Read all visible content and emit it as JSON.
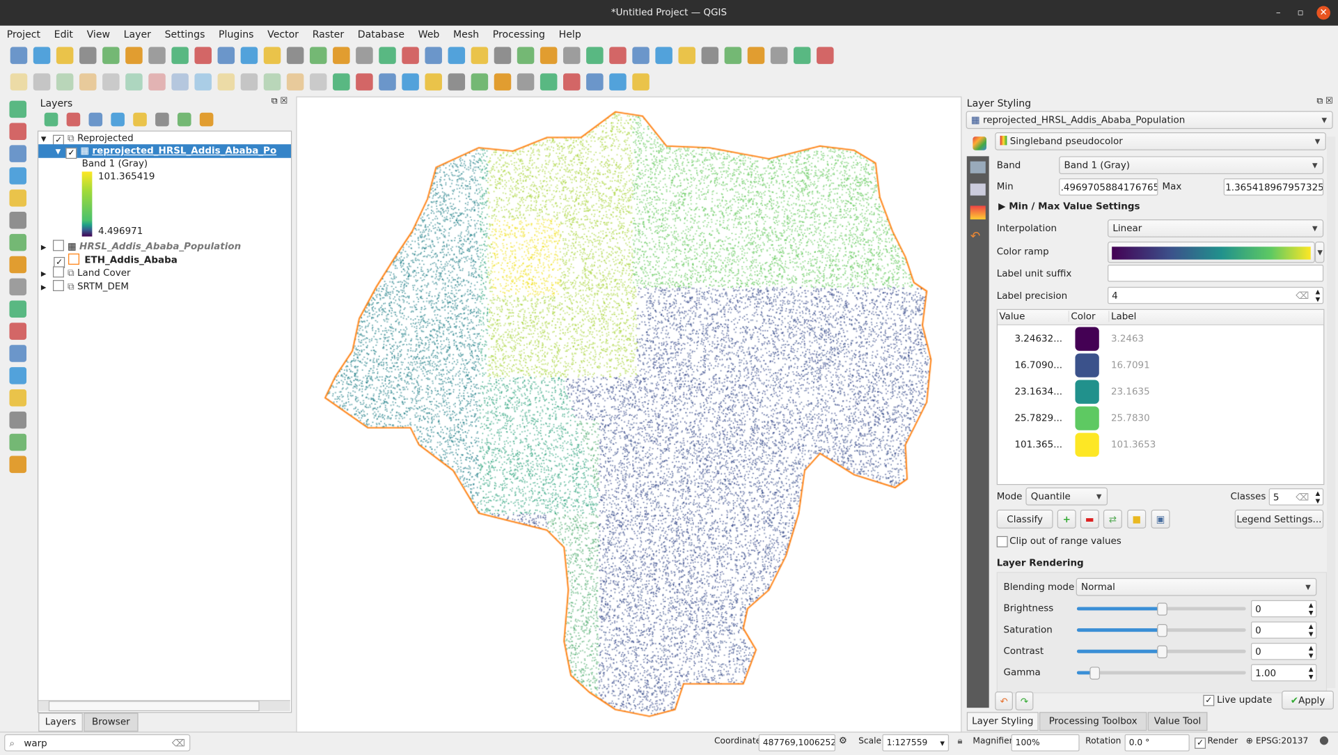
{
  "window": {
    "title": "*Untitled Project — QGIS"
  },
  "menu": [
    "Project",
    "Edit",
    "View",
    "Layer",
    "Settings",
    "Plugins",
    "Vector",
    "Raster",
    "Database",
    "Web",
    "Mesh",
    "Processing",
    "Help"
  ],
  "layers_panel": {
    "title": "Layers",
    "tree": [
      {
        "name": "Reprojected",
        "checked": true,
        "type": "group"
      },
      {
        "name": "reprojected_HRSL_Addis_Ababa_Po",
        "checked": true,
        "type": "raster",
        "selected": true
      },
      {
        "name": "HRSL_Addis_Ababa_Population",
        "checked": false,
        "type": "raster"
      },
      {
        "name": "ETH_Addis_Ababa",
        "checked": true,
        "type": "vector"
      },
      {
        "name": "Land Cover",
        "checked": false,
        "type": "group"
      },
      {
        "name": "SRTM_DEM",
        "checked": false,
        "type": "group"
      }
    ],
    "legend": {
      "band": "Band 1 (Gray)",
      "max": "101.365419",
      "min": "4.496971"
    },
    "tabs": [
      "Layers",
      "Browser"
    ]
  },
  "locator": {
    "value": "warp"
  },
  "styling": {
    "title": "Layer Styling",
    "layer": "reprojected_HRSL_Addis_Ababa_Population",
    "renderer": "Singleband pseudocolor",
    "band_label": "Band",
    "band": "Band 1 (Gray)",
    "min_label": "Min",
    "min": ".4969705884176765",
    "max_label": "Max",
    "max": "1.365418967957325",
    "minmax_settings": "Min / Max Value Settings",
    "interpolation_label": "Interpolation",
    "interpolation": "Linear",
    "color_ramp_label": "Color ramp",
    "unit_suffix_label": "Label unit suffix",
    "unit_suffix": "",
    "precision_label": "Label precision",
    "precision": "4",
    "table_headers": [
      "Value",
      "Color",
      "Label"
    ],
    "classes": [
      {
        "value": "3.24632...",
        "color": "#440154",
        "label": "3.2463"
      },
      {
        "value": "16.7090...",
        "color": "#3b528b",
        "label": "16.7091"
      },
      {
        "value": "23.1634...",
        "color": "#21918c",
        "label": "23.1635"
      },
      {
        "value": "25.7829...",
        "color": "#5ec962",
        "label": "25.7830"
      },
      {
        "value": "101.365...",
        "color": "#fde725",
        "label": "101.3653"
      }
    ],
    "mode_label": "Mode",
    "mode": "Quantile",
    "classes_label": "Classes",
    "classes_count": "5",
    "classify": "Classify",
    "legend_settings": "Legend Settings...",
    "clip_label": "Clip out of range values",
    "rendering_title": "Layer Rendering",
    "blending_label": "Blending mode",
    "blending": "Normal",
    "brightness_label": "Brightness",
    "brightness": "0",
    "saturation_label": "Saturation",
    "saturation": "0",
    "contrast_label": "Contrast",
    "contrast": "0",
    "gamma_label": "Gamma",
    "gamma": "1.00",
    "live_update": "Live update",
    "apply": "Apply",
    "tabs": [
      "Layer Styling",
      "Processing Toolbox",
      "Value Tool"
    ]
  },
  "statusbar": {
    "coordinate_label": "Coordinate",
    "coordinate": "487769,1006252",
    "scale_label": "Scale",
    "scale": "1:127559",
    "magnifier_label": "Magnifier",
    "magnifier": "100%",
    "rotation_label": "Rotation",
    "rotation": "0.0 °",
    "render_label": "Render",
    "crs": "EPSG:20137"
  },
  "colors": {
    "boundary": "#ff7f0e",
    "selection": "#3584c8"
  }
}
